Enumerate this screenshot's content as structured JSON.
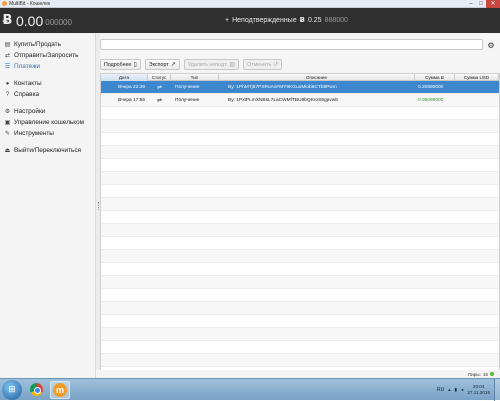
{
  "window": {
    "title": "MultiBit - Кошелек"
  },
  "header": {
    "balance_main": "0.00",
    "balance_frac": "000000",
    "unconfirmed_label": "Неподтвержденные",
    "unconfirmed_main": "0.25",
    "unconfirmed_frac": "888000"
  },
  "sidebar": {
    "items": [
      {
        "label": "Купить/Продать",
        "icon": "bank-icon"
      },
      {
        "label": "Отправить/Запросить",
        "icon": "send-request-icon"
      },
      {
        "label": "Платежи",
        "icon": "payments-list-icon"
      },
      {
        "label": "Контакты",
        "icon": "user-icon"
      },
      {
        "label": "Справка",
        "icon": "help-icon"
      },
      {
        "label": "Настройки",
        "icon": "gear-icon"
      },
      {
        "label": "Управление кошельком",
        "icon": "wallet-manage-icon"
      },
      {
        "label": "Инструменты",
        "icon": "wrench-icon"
      },
      {
        "label": "Выйти/Переключиться",
        "icon": "exit-icon"
      }
    ],
    "active_index": 2
  },
  "search": {
    "placeholder": ""
  },
  "toolbar": {
    "details": "Подробнее",
    "export": "Экспорт",
    "delete_unconfirmed": "Удалить неподт.",
    "undo": "Отменить"
  },
  "table": {
    "columns": [
      "Дата",
      "Статус",
      "Тип",
      "Описание",
      "Сумма",
      "Сумма USD"
    ],
    "amount_unit": "Ƀ",
    "rows": [
      {
        "date": "Вчера 22:39",
        "type": "Получение",
        "description": "By: 1PhMTj57PXRuAxFMY9KGuoMiob6CTb8Pwm",
        "amount": "0.20680000",
        "usd": ""
      },
      {
        "date": "Вчера 17:55",
        "type": "Получение",
        "description": "By: 1PxtPLmXNBsL7LaCWMfTBU9bQKroS9gpvw8",
        "amount": "0.05088000",
        "usd": ""
      }
    ]
  },
  "status": {
    "peers_label": "Пиры:",
    "peers_count": "16"
  },
  "taskbar": {
    "lang": "RU",
    "time": "20:04",
    "date": "27.11.2016"
  },
  "colors": {
    "header_bg": "#2f2f2f",
    "selected_row": "#3d87cf",
    "positive_amount": "#2f9b34",
    "active_nav": "#2a6fb0"
  }
}
